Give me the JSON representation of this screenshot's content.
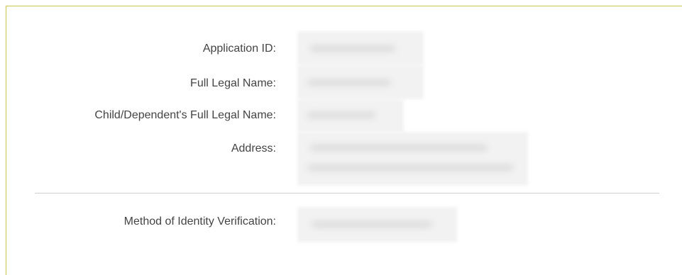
{
  "details": {
    "application_id_label": "Application ID:",
    "full_legal_name_label": "Full Legal Name:",
    "dependent_name_label": "Child/Dependent's Full Legal Name:",
    "address_label": "Address:",
    "verification_method_label": "Method of Identity Verification:"
  }
}
